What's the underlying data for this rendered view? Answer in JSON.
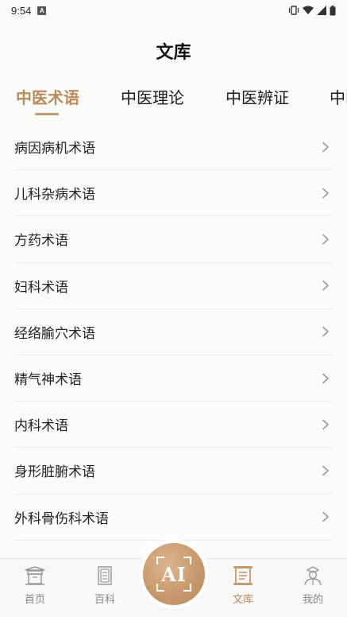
{
  "status": {
    "time": "9:54",
    "notification_icon": "a-badge"
  },
  "header": {
    "title": "文库"
  },
  "tabs": [
    {
      "label": "中医术语",
      "active": true
    },
    {
      "label": "中医理论",
      "active": false
    },
    {
      "label": "中医辨证",
      "active": false
    },
    {
      "label": "中医",
      "active": false
    }
  ],
  "list": [
    {
      "label": "病因病机术语"
    },
    {
      "label": "儿科杂病术语"
    },
    {
      "label": "方药术语"
    },
    {
      "label": "妇科术语"
    },
    {
      "label": "经络腧穴术语"
    },
    {
      "label": "精气神术语"
    },
    {
      "label": "内科术语"
    },
    {
      "label": "身形脏腑术语"
    },
    {
      "label": "外科骨伤科术语"
    }
  ],
  "bottom_nav": {
    "items": [
      {
        "label": "首页",
        "icon": "home-pavilion-icon",
        "active": false
      },
      {
        "label": "百科",
        "icon": "encyclopedia-icon",
        "active": false
      },
      {
        "label": "文库",
        "icon": "scroll-library-icon",
        "active": true
      },
      {
        "label": "我的",
        "icon": "profile-scholar-icon",
        "active": false
      }
    ],
    "ai_button": {
      "label": "AI"
    }
  },
  "colors": {
    "accent": "#b98a5b",
    "text": "#222222",
    "divider": "#e8e8e6",
    "inactive": "#8a8a8a"
  }
}
